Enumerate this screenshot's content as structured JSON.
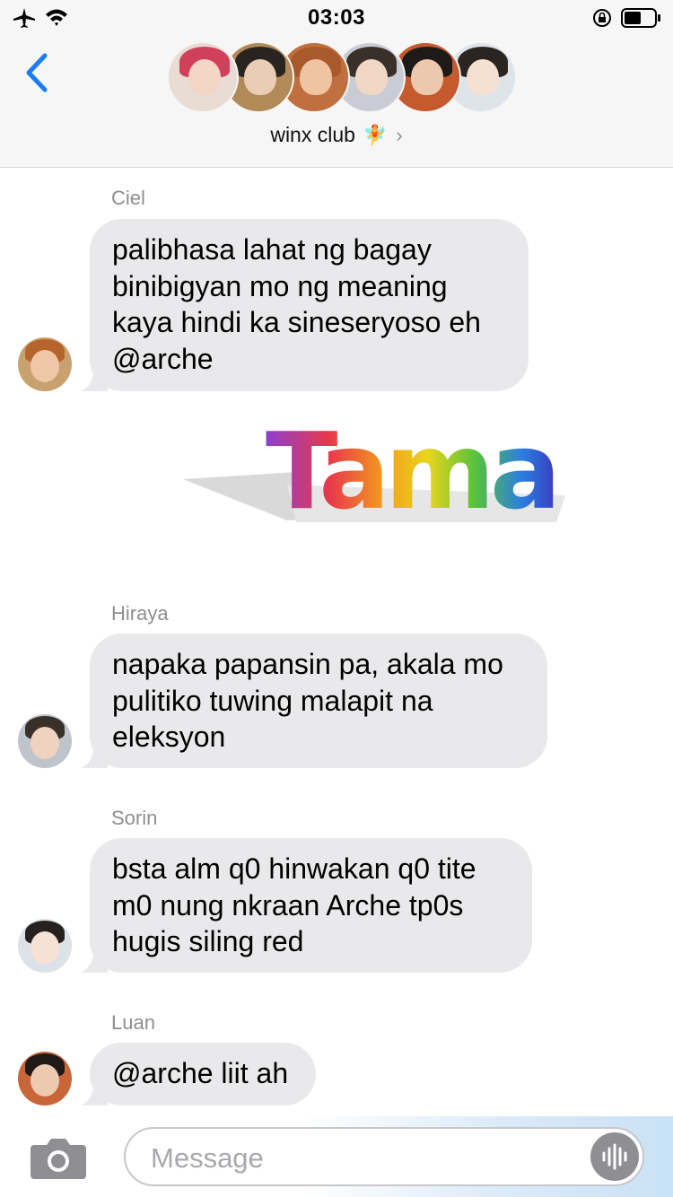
{
  "status_bar": {
    "time": "03:03",
    "icons": [
      "airplane-icon",
      "wifi-icon",
      "orientation-lock-icon",
      "battery-icon"
    ]
  },
  "header": {
    "back_icon": "chevron-left-icon",
    "group_name": "winx club",
    "group_emoji": "🧚",
    "chevron": "›",
    "avatar_count": 6
  },
  "messages": [
    {
      "sender": "Ciel",
      "text": "palibhasa lahat ng bagay binibigyan mo ng meaning kaya hindi ka sineseryoso eh @arche"
    },
    {
      "sender": "",
      "sticker_text": "Tama"
    },
    {
      "sender": "Hiraya",
      "text": "napaka papansin pa, akala mo pulitiko tuwing malapit na eleksyon"
    },
    {
      "sender": "Sorin",
      "text": "bsta alm q0 hinwakan q0 tite m0 nung nkraan Arche tp0s hugis siling red"
    },
    {
      "sender": "Luan",
      "text": "@arche liit ah"
    }
  ],
  "input_bar": {
    "placeholder": "Message",
    "value": "",
    "camera_icon": "camera-icon",
    "audio_icon": "audio-waveform-icon"
  },
  "colors": {
    "accent": "#1a7cf5",
    "bubble": "#e9e9eb",
    "secondary_text": "#8e8e93",
    "header_bg": "#f6f6f6"
  }
}
